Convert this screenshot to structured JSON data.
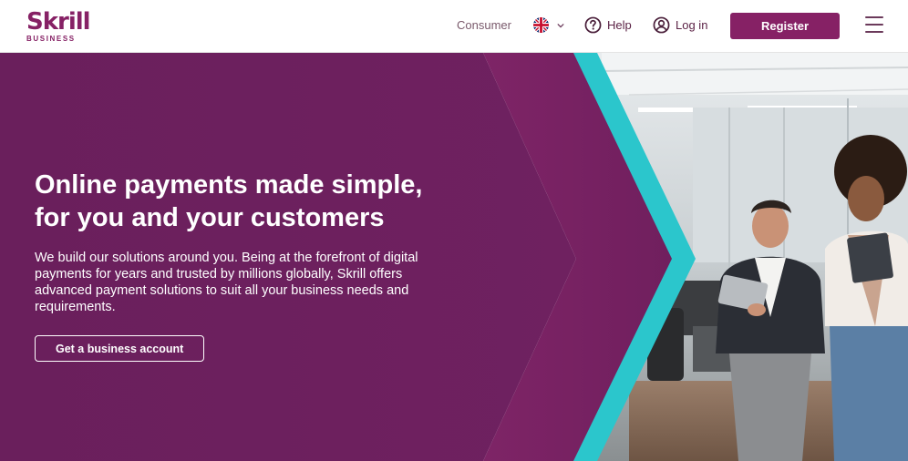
{
  "brand": {
    "name": "Skrill",
    "subtitle": "BUSINESS",
    "color": "#862165"
  },
  "nav": {
    "consumer": "Consumer",
    "language_icon": "uk-flag-icon",
    "help": "Help",
    "login": "Log in",
    "register": "Register",
    "menu_icon": "hamburger-menu-icon"
  },
  "hero": {
    "headline_line1": "Online payments made simple,",
    "headline_line2": "for you and your customers",
    "body": "We build our solutions around you. Being at the forefront of digital payments for years and trusted by millions globally, Skrill offers advanced payment solutions to suit all your business needs and requirements.",
    "cta": "Get a business account",
    "colors": {
      "purple_dark": "#6a1f5c",
      "purple_mid": "#7b2463",
      "teal_accent": "#2bc6cc"
    }
  }
}
